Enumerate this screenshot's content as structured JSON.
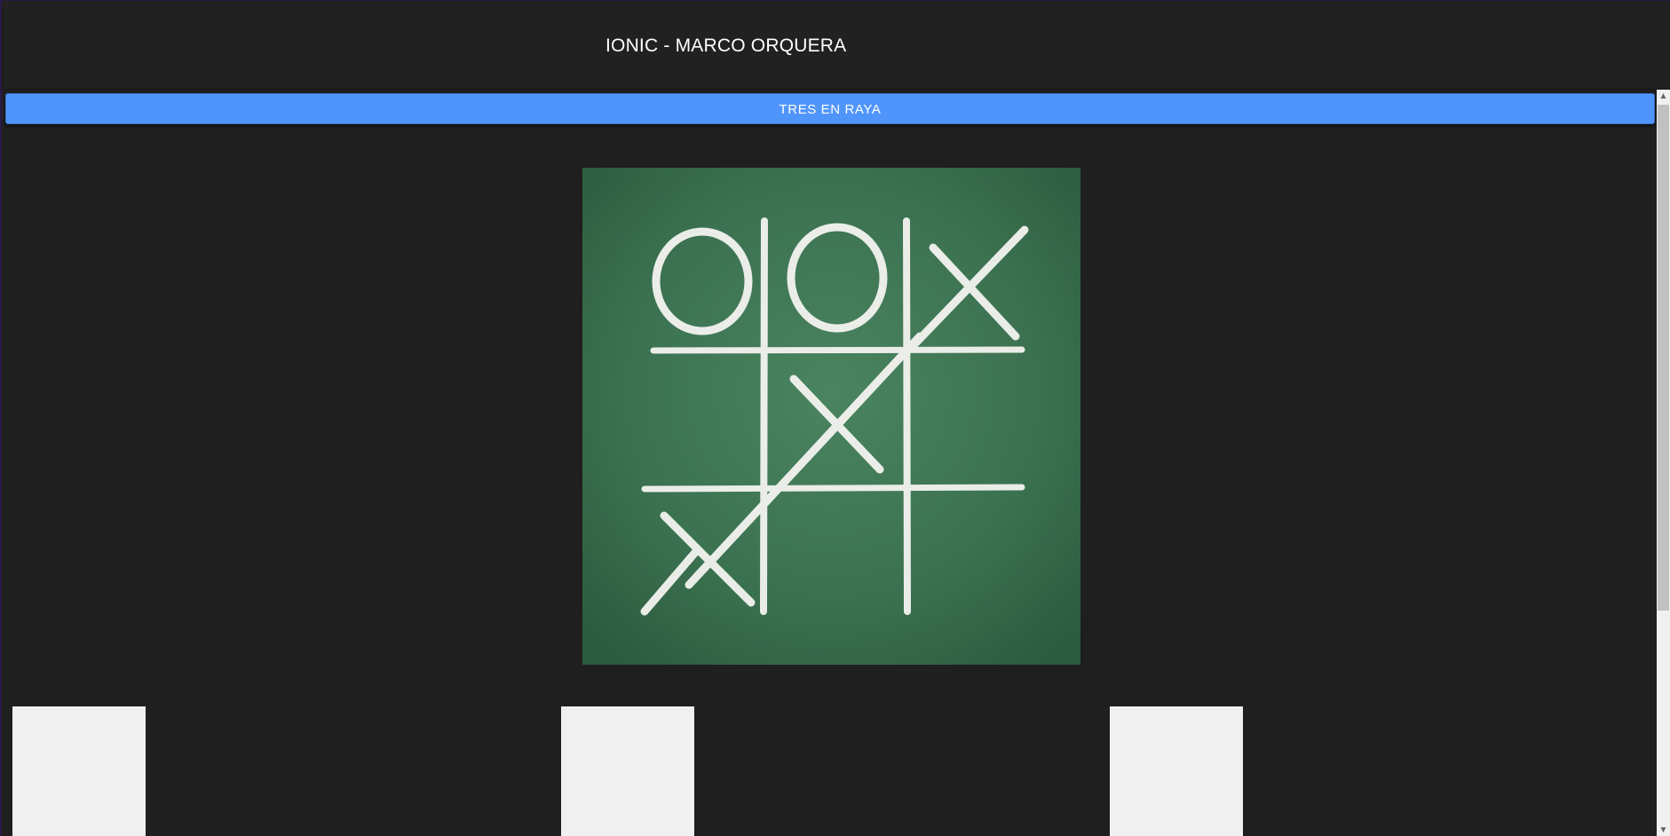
{
  "header": {
    "title": "IONIC - MARCO ORQUERA"
  },
  "main": {
    "game_button_label": "TRES EN RAYA",
    "board_image": {
      "alt": "tic-tac-toe chalkboard",
      "board_color": "#3b7150",
      "chalk_color": "#f4f4f0",
      "marks": [
        [
          "O",
          "O",
          "X"
        ],
        [
          "",
          "X",
          ""
        ],
        [
          "X",
          "",
          ""
        ]
      ]
    },
    "cells": [
      "",
      "",
      ""
    ]
  },
  "scrollbar": {
    "up_icon": "▲",
    "down_icon": "▼"
  },
  "colors": {
    "background": "#1f1f1f",
    "header": "#212121",
    "button": "#5095fb",
    "cell": "#f0f0f0"
  }
}
